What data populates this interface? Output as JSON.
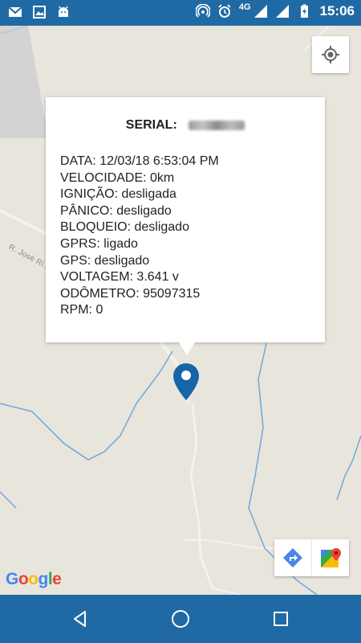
{
  "status_bar": {
    "time": "15:06",
    "network": "4G",
    "icons": [
      "gmail-icon",
      "image-icon",
      "android-icon",
      "hotspot-icon",
      "alarm-icon",
      "signal-icon",
      "battery-charging-icon"
    ]
  },
  "map": {
    "street_label": "R. José Ri...",
    "google_logo": "Google"
  },
  "info_window": {
    "serial_label": "SERIAL:",
    "lines": [
      "DATA: 12/03/18 6:53:04 PM",
      "VELOCIDADE: 0km",
      "IGNIÇÃO: desligada",
      "PÂNICO: desligado",
      "BLOQUEIO: desligado",
      "GPRS: ligado",
      "GPS: desligado",
      "VOLTAGEM: 3.641 v",
      "ODÔMETRO: 95097315",
      "RPM: 0"
    ]
  },
  "colors": {
    "status_bar": "#1f6aa5",
    "pin": "#1565a8",
    "water": "#6fa8d8"
  }
}
